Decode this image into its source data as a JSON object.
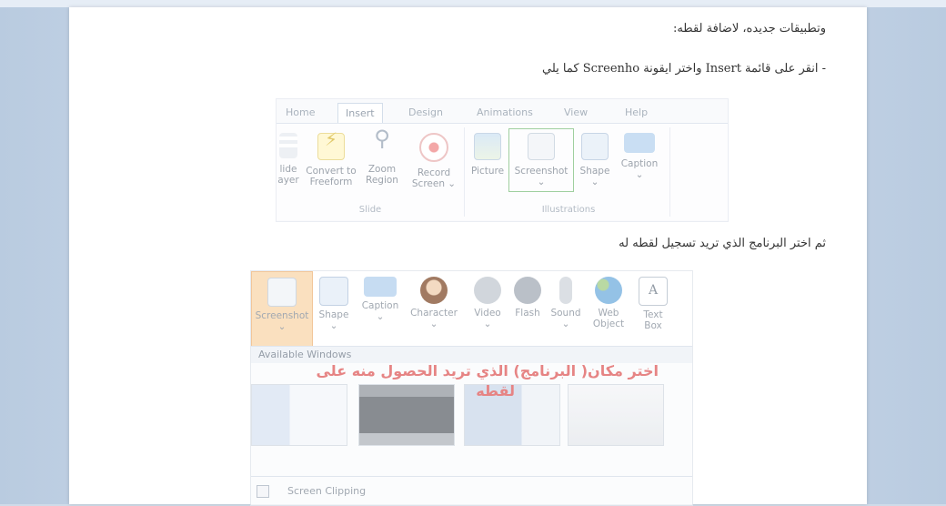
{
  "document": {
    "line1": "وتطبيقات جديده، لاضافة لقطه:",
    "line2": "- انقر على قائمة Insert واختر ايقونة Screenho كما يلي",
    "line3": "ثم اختر البرنامج الذي تريد تسجيل لقطه له"
  },
  "ribbon1": {
    "tabs": [
      "Home",
      "Insert",
      "Design",
      "Animations",
      "View",
      "Help"
    ],
    "active_tab": "Insert",
    "slide_group": {
      "label": "Slide",
      "buttons": [
        {
          "line1": "lide",
          "line2": "ayer",
          "icon": "slide-icon"
        },
        {
          "line1": "Convert to",
          "line2": "Freeform",
          "icon": "lightning-icon"
        },
        {
          "line1": "Zoom",
          "line2": "Region",
          "icon": "zoom-icon"
        },
        {
          "line1": "Record",
          "line2": "Screen ⌄",
          "icon": "record-icon"
        }
      ]
    },
    "illustrations_group": {
      "label": "Illustrations",
      "buttons": [
        {
          "line1": "Picture",
          "line2": "",
          "icon": "picture-icon"
        },
        {
          "line1": "Screenshot",
          "line2": "⌄",
          "icon": "screenshot-icon"
        },
        {
          "line1": "Shape",
          "line2": "⌄",
          "icon": "shape-icon"
        },
        {
          "line1": "Caption",
          "line2": "⌄",
          "icon": "caption-icon"
        }
      ]
    }
  },
  "ribbon2": {
    "buttons": [
      {
        "line1": "Screenshot",
        "line2": "⌄",
        "icon": "screenshot-icon"
      },
      {
        "line1": "Shape",
        "line2": "⌄",
        "icon": "shape-icon"
      },
      {
        "line1": "Caption",
        "line2": "⌄",
        "icon": "caption-icon"
      },
      {
        "line1": "Character",
        "line2": "⌄",
        "icon": "character-icon"
      },
      {
        "line1": "Video",
        "line2": "⌄",
        "icon": "video-icon"
      },
      {
        "line1": "Flash",
        "line2": "",
        "icon": "flash-icon"
      },
      {
        "line1": "Sound",
        "line2": "⌄",
        "icon": "sound-icon"
      },
      {
        "line1": "Web",
        "line2": "Object",
        "icon": "web-object-icon"
      },
      {
        "line1": "Text",
        "line2": "Box",
        "icon": "text-box-icon"
      }
    ],
    "available_windows": "Available Windows",
    "annotation_line1": "اختر مكان( البرنامج) الذي تريد الحصول منه على",
    "annotation_line2": "لقطه",
    "screen_clipping": "Screen Clipping"
  },
  "colors": {
    "page_bg": "#ffffff",
    "desk_bg": "#cfdbe9",
    "annotation_red": "#e06666",
    "highlight_green": "#7fc07f",
    "highlight_orange": "#f9d9b0"
  }
}
